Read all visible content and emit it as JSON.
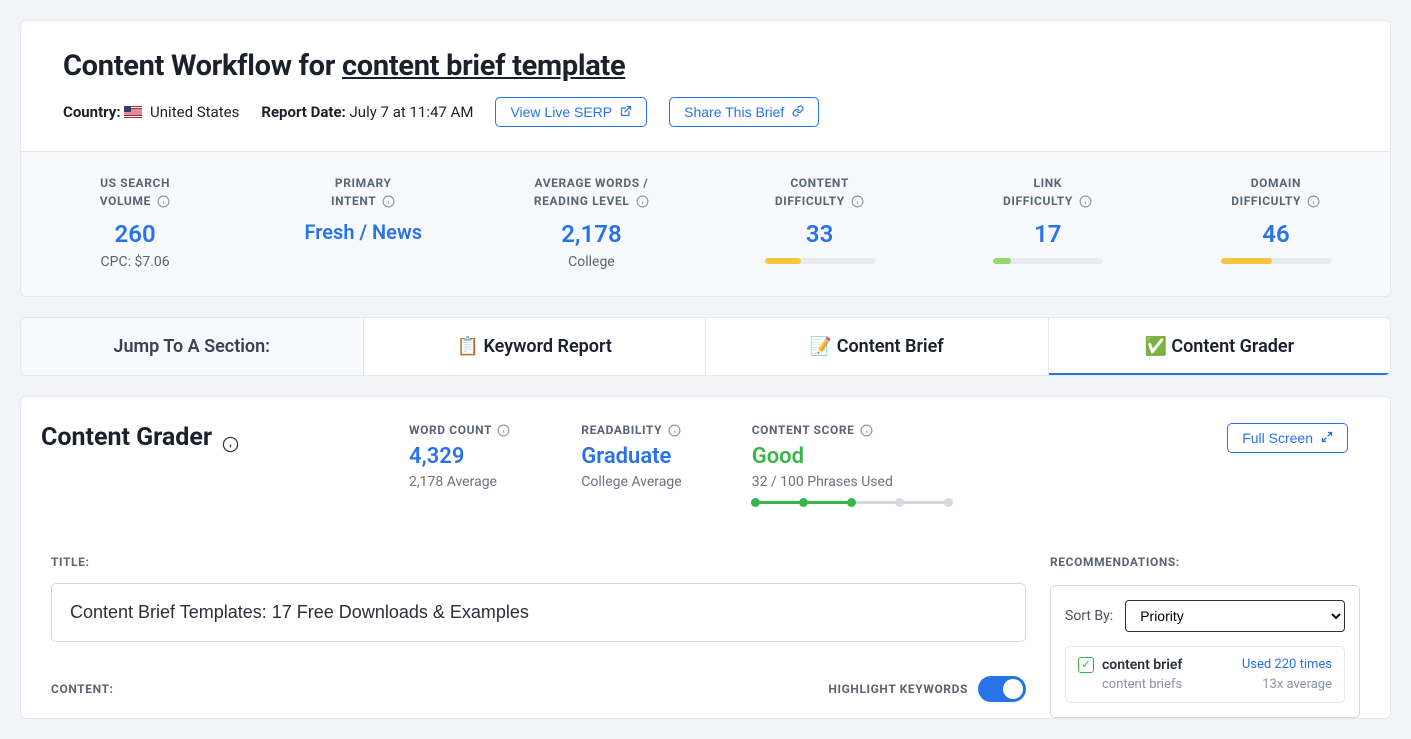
{
  "header": {
    "title_prefix": "Content Workflow for ",
    "keyword": "content brief template",
    "country_label": "Country:",
    "country_value": "United States",
    "report_date_label": "Report Date:",
    "report_date_value": "July 7 at 11:47 AM",
    "view_live_serp": "View Live SERP",
    "share_brief": "Share This Brief"
  },
  "metrics": {
    "search_volume": {
      "label_line1": "US SEARCH",
      "label_line2": "VOLUME",
      "value": "260",
      "sub": "CPC: $7.06"
    },
    "primary_intent": {
      "label_line1": "PRIMARY",
      "label_line2": "INTENT",
      "value": "Fresh / News"
    },
    "avg_words": {
      "label_line1": "AVERAGE WORDS /",
      "label_line2": "READING LEVEL",
      "value": "2,178",
      "sub": "College"
    },
    "content_diff": {
      "label_line1": "CONTENT",
      "label_line2": "DIFFICULTY",
      "value": "33"
    },
    "link_diff": {
      "label_line1": "LINK",
      "label_line2": "DIFFICULTY",
      "value": "17"
    },
    "domain_diff": {
      "label_line1": "DOMAIN",
      "label_line2": "DIFFICULTY",
      "value": "46"
    }
  },
  "tabs": {
    "jump": "Jump To A Section:",
    "keyword_report": "📋 Keyword Report",
    "content_brief": "📝 Content Brief",
    "content_grader": "✅ Content Grader"
  },
  "grader": {
    "title": "Content Grader",
    "full_screen": "Full Screen",
    "word_count": {
      "label": "WORD COUNT",
      "value": "4,329",
      "sub": "2,178 Average"
    },
    "readability": {
      "label": "READABILITY",
      "value": "Graduate",
      "sub": "College Average"
    },
    "content_score": {
      "label": "CONTENT SCORE",
      "value": "Good",
      "sub": "32 / 100 Phrases Used"
    }
  },
  "editor": {
    "title_label": "TITLE:",
    "title_value": "Content Brief Templates: 17 Free Downloads & Examples",
    "content_label": "CONTENT:",
    "highlight_label": "HIGHLIGHT KEYWORDS"
  },
  "recommendations": {
    "heading": "RECOMMENDATIONS:",
    "sort_label": "Sort By:",
    "sort_value": "Priority",
    "item": {
      "keyword": "content brief",
      "used": "Used 220 times",
      "sub_kw": "content briefs",
      "avg": "13x average"
    }
  }
}
